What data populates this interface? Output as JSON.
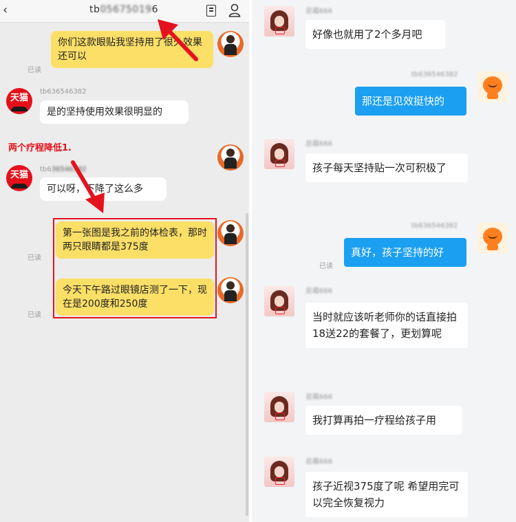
{
  "left": {
    "header": {
      "title_prefix": "tb",
      "title_blurred": "05675019",
      "title_suffix": "6"
    },
    "messages": [
      {
        "text": "你们这款眼贴我坚持用了很久效果还可以",
        "read": "已读"
      },
      {
        "nick_prefix": "tb636546382",
        "text": "是的坚持使用效果很明显的"
      },
      {
        "annotation": "两个疗程降低1."
      },
      {
        "nick_prefix": "tb6",
        "nick_blurred": "36546382",
        "text": "可以呀，下降了这么多"
      },
      {
        "text": "第一张图是我之前的体检表，那时两只眼睛都是375度",
        "read": "已读"
      },
      {
        "text": "今天下午路过眼镜店测了一下，现在是200度和250度",
        "read": "已读"
      }
    ],
    "tmall_label": "天猫"
  },
  "right": {
    "messages": [
      {
        "from": "customer",
        "nick": "总裁666",
        "text": "好像也就用了2个多月吧"
      },
      {
        "from": "seller",
        "nick": "tb636546382",
        "text": "那还是见效挺快的"
      },
      {
        "from": "customer",
        "nick": "总裁666",
        "text": "孩子每天坚持贴一次可积极了"
      },
      {
        "from": "seller",
        "nick": "tb636546382",
        "text": "真好，孩子坚持的好",
        "read": "已读"
      },
      {
        "from": "customer",
        "nick": "总裁666",
        "text": "当时就应该听老师你的话直接拍18送22的套餐了，更划算呢"
      },
      {
        "from": "customer",
        "nick": "总裁666",
        "text": "我打算再拍一疗程给孩子用"
      },
      {
        "from": "customer",
        "nick": "总裁666",
        "text": "孩子近视375度了呢 希望用完可以完全恢复视力"
      }
    ]
  },
  "colors": {
    "annotation_red": "#e4121d",
    "seller_bubble_blue": "#1b9ff0",
    "user_bubble_yellow": "#fbdf67"
  },
  "icons": [
    "back-icon",
    "document-icon",
    "person-icon",
    "red-arrow"
  ]
}
